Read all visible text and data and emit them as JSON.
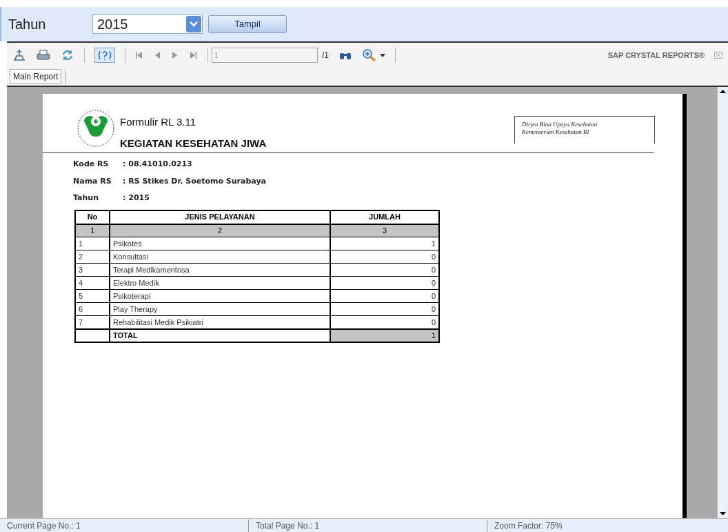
{
  "filter": {
    "label": "Tahun",
    "year": "2015",
    "button": "Tampil"
  },
  "toolbar": {
    "page_input": "1",
    "page_total": "/1",
    "brand": "SAP CRYSTAL REPORTS®"
  },
  "tabs": [
    {
      "label": "Main Report",
      "selected": true
    }
  ],
  "report": {
    "title": "Formulir RL 3.11",
    "subtitle": "KEGIATAN KESEHATAN JIWA",
    "issuer_lines": [
      "Dirjen Bina Upaya Kesehatan",
      "Kementerian Kesehatan RI"
    ],
    "fields": [
      {
        "label": "Kode RS",
        "value": ": 08.41010.0213"
      },
      {
        "label": "Nama RS",
        "value": ": RS Stikes Dr. Soetomo Surabaya"
      },
      {
        "label": "Tahun",
        "value": ": 2015"
      }
    ],
    "table": {
      "columns": [
        "No",
        "JENIS PELAYANAN",
        "JUMLAH"
      ],
      "column_numbers": [
        "1",
        "2",
        "3"
      ],
      "rows": [
        {
          "no": "1",
          "service": "Psikotes",
          "count": "1"
        },
        {
          "no": "2",
          "service": "Konsultasi",
          "count": "0"
        },
        {
          "no": "3",
          "service": "Terapi Medikamentosa",
          "count": "0"
        },
        {
          "no": "4",
          "service": "Elektro Medik",
          "count": "0"
        },
        {
          "no": "5",
          "service": "Psikoterapi",
          "count": "0"
        },
        {
          "no": "6",
          "service": "Play Therapy",
          "count": "0"
        },
        {
          "no": "7",
          "service": "Rehabilitasi Medik Psikiatri",
          "count": "0"
        }
      ],
      "total": {
        "label": "TOTAL",
        "count": "1"
      }
    }
  },
  "status_bar": [
    "Current Page No.: 1",
    "Total Page No.: 1",
    "Zoom Factor: 75%"
  ]
}
